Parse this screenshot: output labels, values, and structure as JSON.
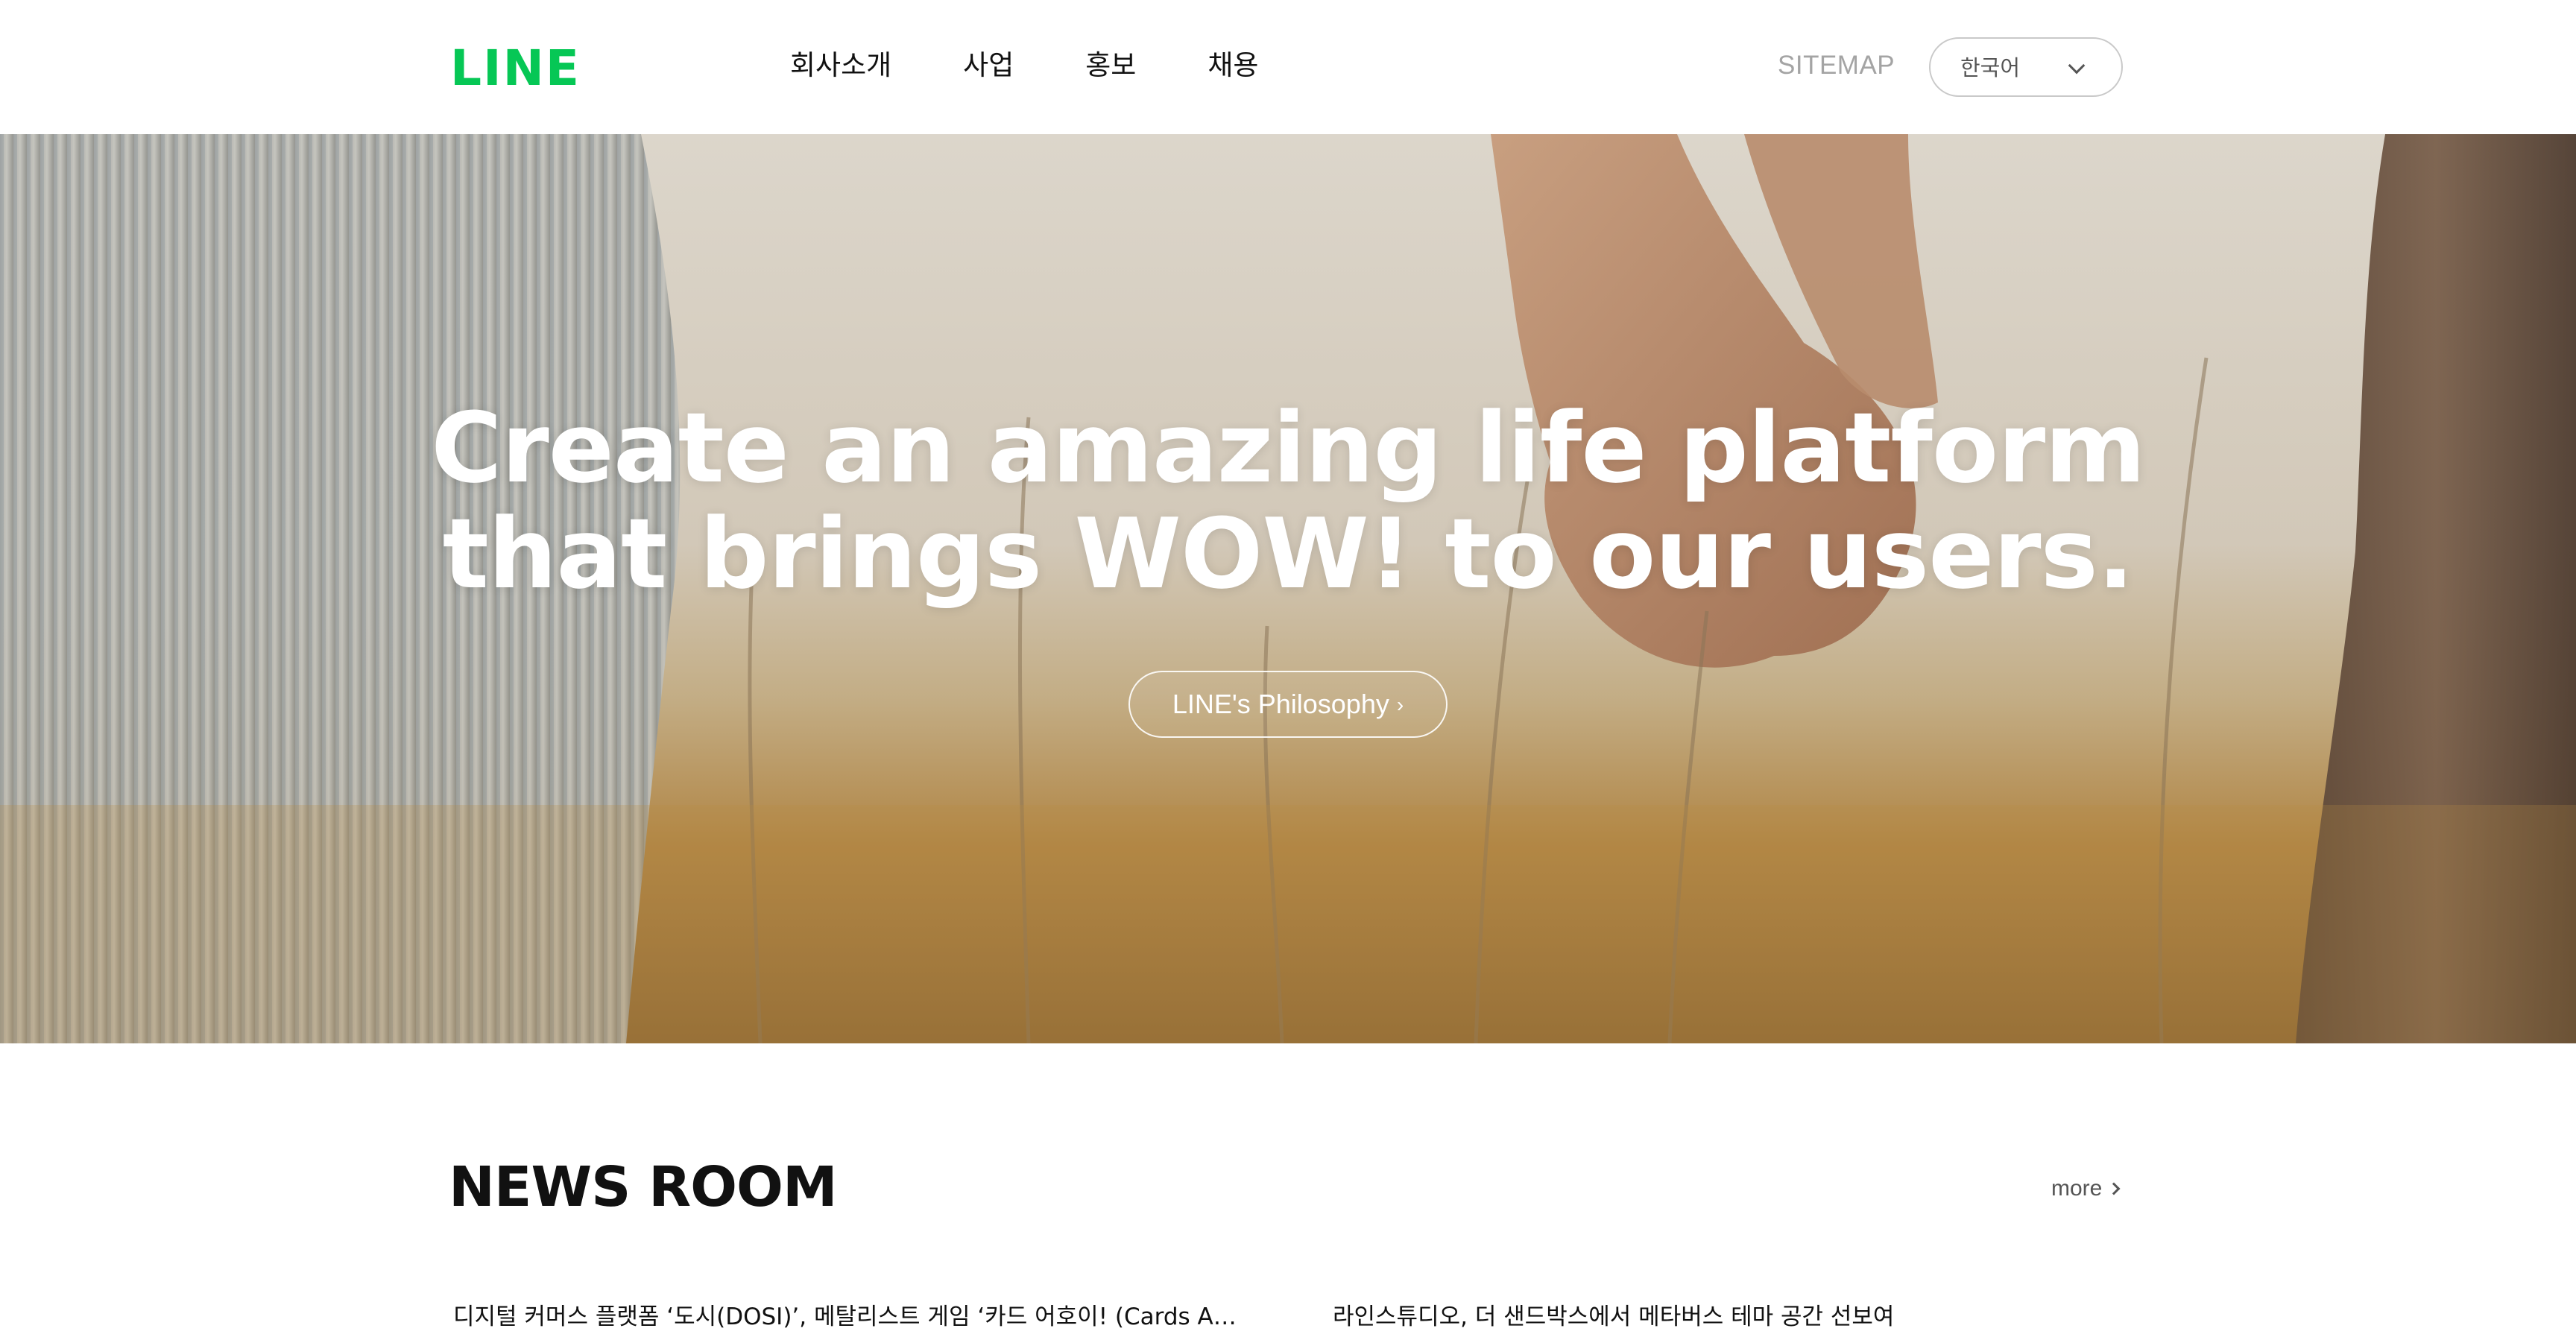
{
  "header": {
    "logo": "LINE",
    "nav": [
      "회사소개",
      "사업",
      "홍보",
      "채용"
    ],
    "sitemap": "SITEMAP",
    "language": "한국어"
  },
  "hero": {
    "title_line1": "Create an amazing life platform",
    "title_line2": "that brings WOW! to our users.",
    "button_label": "LINE's Philosophy",
    "button_arrow": "›"
  },
  "news": {
    "title": "NEWS ROOM",
    "more": "more",
    "items": [
      "디지털 커머스 플랫폼 ‘도시(DOSI)’, 메탈리스트 게임 ‘카드 어호이! (Cards Ahoy!)’ 아이템 판매",
      "라인스튜디오, 더 샌드박스에서 메타버스 테마 공간 선보여"
    ]
  },
  "colors": {
    "brand_green": "#06c755",
    "text_primary": "#111111",
    "text_muted": "#a4a4a4"
  }
}
